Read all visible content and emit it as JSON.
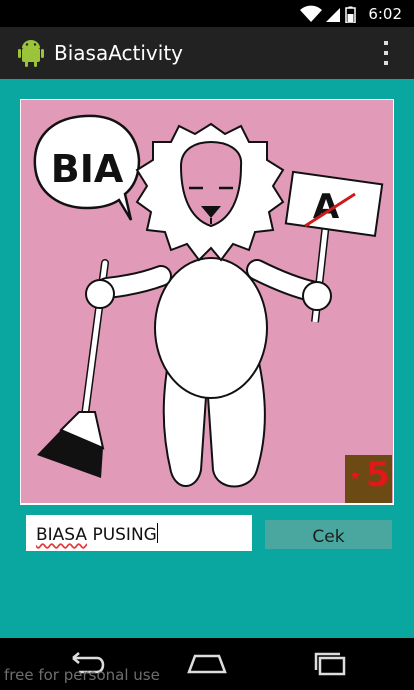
{
  "status_bar": {
    "time": "6:02"
  },
  "action_bar": {
    "title": "BiasaActivity",
    "app_icon": "android-robot-icon",
    "overflow_icon": "overflow-menu-icon"
  },
  "puzzle": {
    "speech_bubble_text": "BIA",
    "sign_text": "A",
    "level_number": "5",
    "level_icon": "star-icon"
  },
  "answer": {
    "value": "BIASA PUSING",
    "misspelled_word": "BIASA",
    "rest": " PUSING"
  },
  "cek_button": {
    "label": "Cek"
  },
  "nav_bar": {
    "back_icon": "back-icon",
    "home_icon": "home-icon",
    "recents_icon": "recents-icon"
  },
  "watermark": "free for personal use",
  "colors": {
    "background": "#0aa6a0",
    "puzzle_bg": "#e29ab9",
    "button": "#4aa7a0",
    "badge": "#6b4a14",
    "badge_text": "#e01818"
  }
}
